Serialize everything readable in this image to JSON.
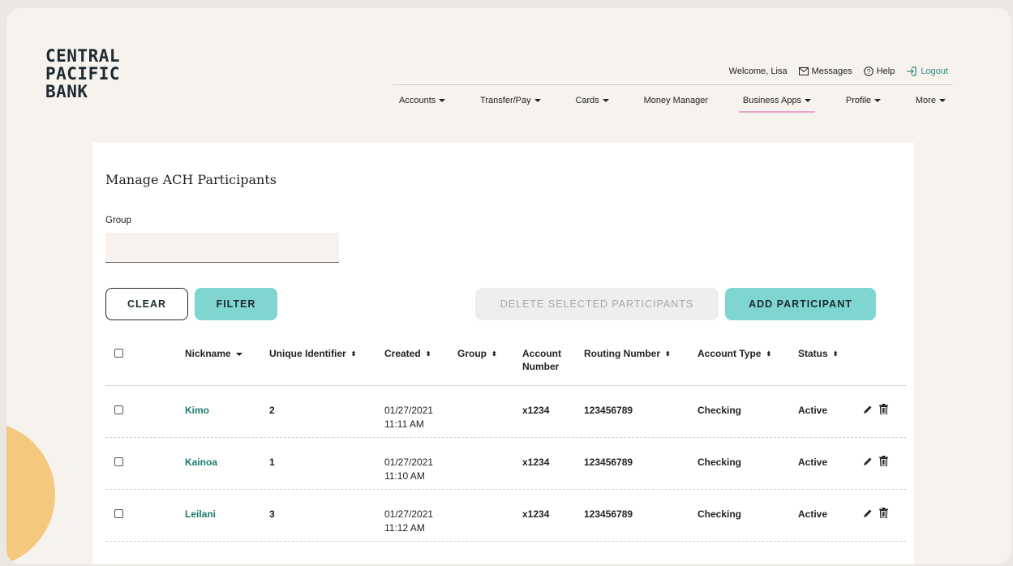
{
  "brand": {
    "line1": "CENTRAL",
    "line2": "PACIFIC",
    "line3": "BANK"
  },
  "utility": {
    "welcome": "Welcome, Lisa",
    "messages": "Messages",
    "help": "Help",
    "logout": "Logout"
  },
  "nav": {
    "accounts": "Accounts",
    "transfer": "Transfer/Pay",
    "cards": "Cards",
    "money_manager": "Money Manager",
    "business_apps": "Business Apps",
    "profile": "Profile",
    "more": "More"
  },
  "page": {
    "title": "Manage ACH Participants",
    "group_label": "Group",
    "group_value": ""
  },
  "buttons": {
    "clear": "CLEAR",
    "filter": "FILTER",
    "delete_selected": "DELETE SELECTED PARTICIPANTS",
    "add": "ADD PARTICIPANT"
  },
  "table": {
    "headers": {
      "nickname": "Nickname",
      "unique_id": "Unique Identifier",
      "created": "Created",
      "group": "Group",
      "account_number_1": "Account",
      "account_number_2": "Number",
      "routing": "Routing Number",
      "account_type": "Account Type",
      "status": "Status"
    },
    "rows": [
      {
        "nickname": "Kimo",
        "unique_id": "2",
        "date": "01/27/2021",
        "time": "11:11 AM",
        "group": "",
        "account": "x1234",
        "routing": "123456789",
        "type": "Checking",
        "status": "Active"
      },
      {
        "nickname": "Kainoa",
        "unique_id": "1",
        "date": "01/27/2021",
        "time": "11:10 AM",
        "group": "",
        "account": "x1234",
        "routing": "123456789",
        "type": "Checking",
        "status": "Active"
      },
      {
        "nickname": "Leilani",
        "unique_id": "3",
        "date": "01/27/2021",
        "time": "11:12 AM",
        "group": "",
        "account": "x1234",
        "routing": "123456789",
        "type": "Checking",
        "status": "Active"
      }
    ]
  },
  "colors": {
    "accent_teal": "#7fd6d0",
    "link_green": "#1c7a6d",
    "active_underline": "#e8a5c8",
    "blob": "#f5c87f"
  }
}
